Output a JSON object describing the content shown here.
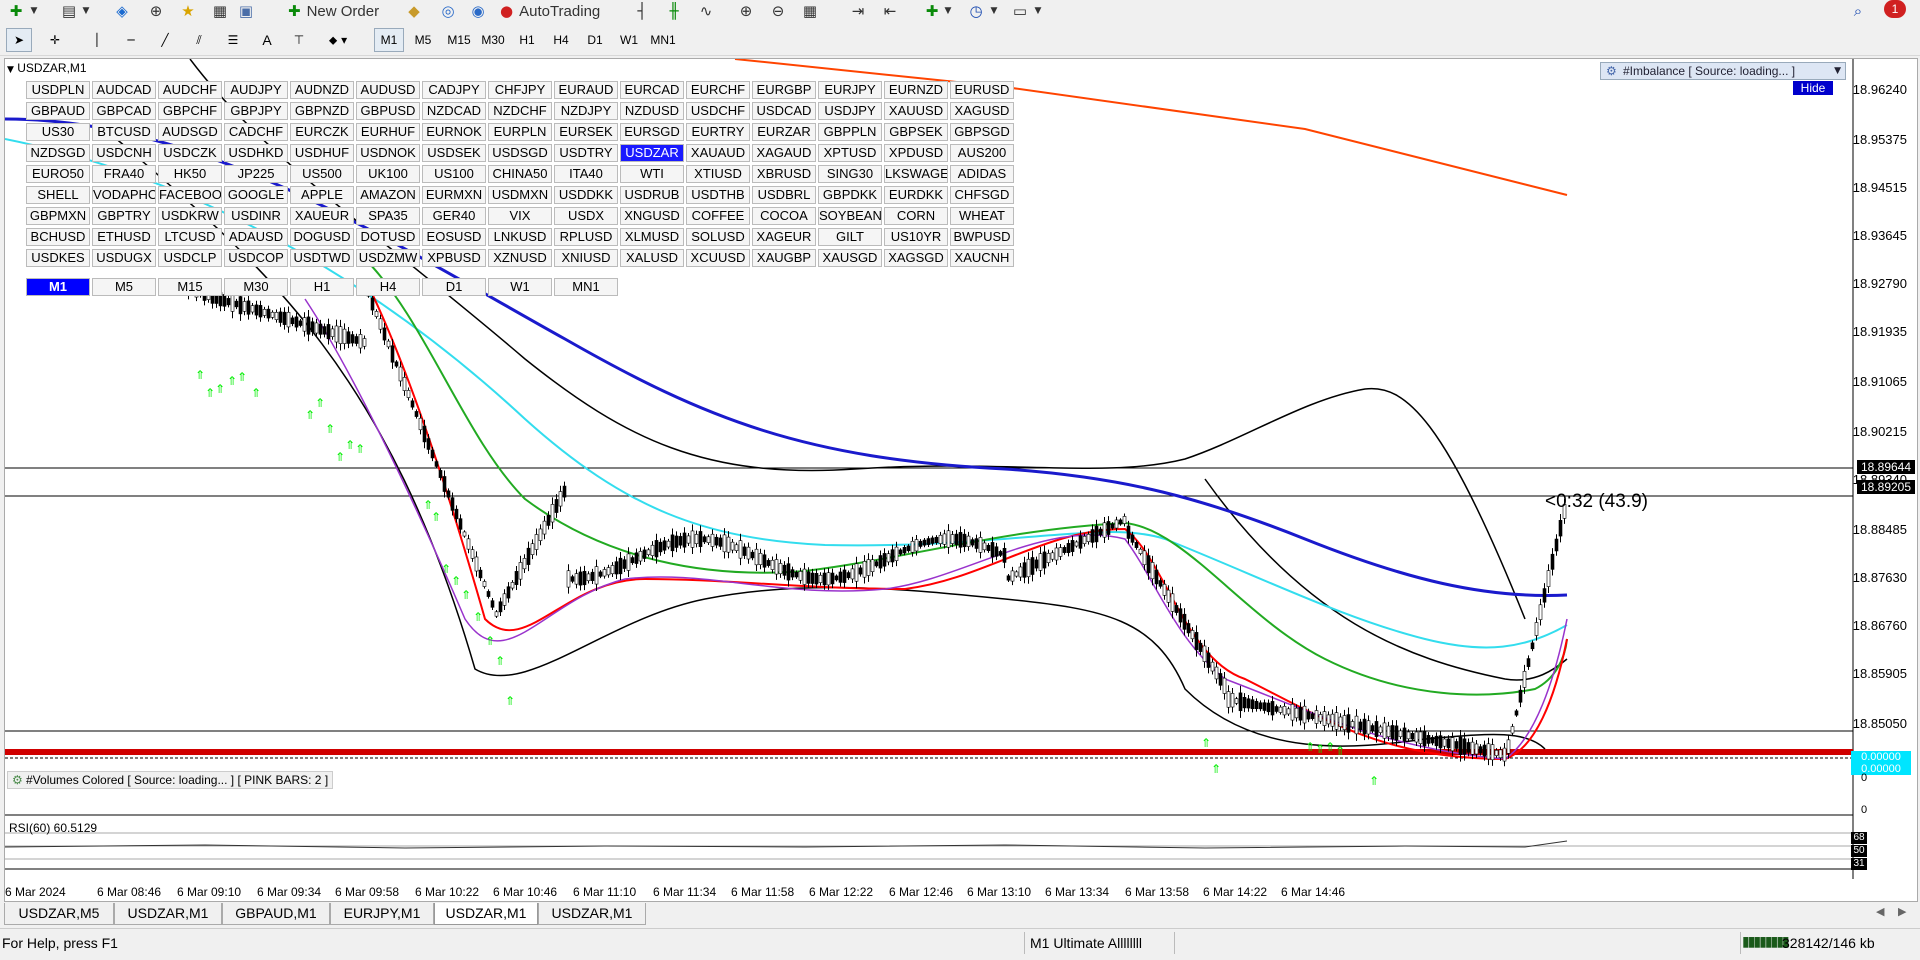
{
  "toolbar": {
    "new_order": "New Order",
    "autotrading": "AutoTrading",
    "timeframes": [
      "M1",
      "M5",
      "M15",
      "M30",
      "H1",
      "H4",
      "D1",
      "W1",
      "MN1"
    ],
    "selected_tf": "M1",
    "notification_count": "1"
  },
  "chart": {
    "title": "USDZAR,M1",
    "countdown": "<0:32 (43.9)",
    "price_labels": [
      "18.96240",
      "18.95375",
      "18.94515",
      "18.93645",
      "18.92790",
      "18.91935",
      "18.91065",
      "18.90215",
      "18.89644",
      "18.89340",
      "18.89205",
      "18.88485",
      "18.87630",
      "18.86760",
      "18.85905",
      "18.85050"
    ],
    "price_tags": [
      "18.89644",
      "18.89205"
    ],
    "date_labels": [
      "6 Mar 2024",
      "6 Mar 08:46",
      "6 Mar 09:10",
      "6 Mar 09:34",
      "6 Mar 09:58",
      "6 Mar 10:22",
      "6 Mar 10:46",
      "6 Mar 11:10",
      "6 Mar 11:34",
      "6 Mar 11:58",
      "6 Mar 12:22",
      "6 Mar 12:46",
      "6 Mar 13:10",
      "6 Mar 13:34",
      "6 Mar 13:58",
      "6 Mar 14:22",
      "6 Mar 14:46"
    ],
    "colors": {
      "ema_fast": "#ff0000",
      "ema_mid": "#9933cc",
      "ema_green": "#22aa22",
      "ema_cyan": "#33ddee",
      "ema_blue": "#1a1acc",
      "bands": "#000000",
      "orange": "#ff4400",
      "arrows": "#00ee00"
    }
  },
  "symbols": [
    [
      "USDPLN",
      "AUDCAD",
      "AUDCHF",
      "AUDJPY",
      "AUDNZD",
      "AUDUSD",
      "CADJPY",
      "CHFJPY",
      "EURAUD",
      "EURCAD",
      "EURCHF",
      "EURGBP",
      "EURJPY",
      "EURNZD",
      "EURUSD"
    ],
    [
      "GBPAUD",
      "GBPCAD",
      "GBPCHF",
      "GBPJPY",
      "GBPNZD",
      "GBPUSD",
      "NZDCAD",
      "NZDCHF",
      "NZDJPY",
      "NZDUSD",
      "USDCHF",
      "USDCAD",
      "USDJPY",
      "XAUUSD",
      "XAGUSD"
    ],
    [
      "US30",
      "BTCUSD",
      "AUDSGD",
      "CADCHF",
      "EURCZK",
      "EURHUF",
      "EURNOK",
      "EURPLN",
      "EURSEK",
      "EURSGD",
      "EURTRY",
      "EURZAR",
      "GBPPLN",
      "GBPSEK",
      "GBPSGD"
    ],
    [
      "NZDSGD",
      "USDCNH",
      "USDCZK",
      "USDHKD",
      "USDHUF",
      "USDNOK",
      "USDSEK",
      "USDSGD",
      "USDTRY",
      "USDZAR",
      "XAUAUD",
      "XAGAUD",
      "XPTUSD",
      "XPDUSD",
      "AUS200"
    ],
    [
      "EURO50",
      "FRA40",
      "HK50",
      "JP225",
      "US500",
      "UK100",
      "US100",
      "CHINA50",
      "ITA40",
      "WTI",
      "XTIUSD",
      "XBRUSD",
      "SING30",
      "LKSWAGE",
      "ADIDAS"
    ],
    [
      "SHELL",
      "VODAPHONE",
      "FACEBOOK",
      "GOOGLE",
      "APPLE",
      "AMAZON",
      "EURMXN",
      "USDMXN",
      "USDDKK",
      "USDRUB",
      "USDTHB",
      "USDBRL",
      "GBPDKK",
      "EURDKK",
      "CHFSGD"
    ],
    [
      "GBPMXN",
      "GBPTRY",
      "USDKRW",
      "USDINR",
      "XAUEUR",
      "SPA35",
      "GER40",
      "VIX",
      "USDX",
      "XNGUSD",
      "COFFEE",
      "COCOA",
      "SOYBEANS",
      "CORN",
      "WHEAT"
    ],
    [
      "BCHUSD",
      "ETHUSD",
      "LTCUSD",
      "ADAUSD",
      "DOGUSD",
      "DOTUSD",
      "EOSUSD",
      "LNKUSD",
      "RPLUSD",
      "XLMUSD",
      "SOLUSD",
      "XAGEUR",
      "GILT",
      "US10YR",
      "BWPUSD"
    ],
    [
      "USDKES",
      "USDUGX",
      "USDCLP",
      "USDCOP",
      "USDTWD",
      "USDZMW",
      "XPBUSD",
      "XZNUSD",
      "XNIUSD",
      "XALUSD",
      "XCUUSD",
      "XAUGBP",
      "XAUSGD",
      "XAGSGD",
      "XAUCNH"
    ]
  ],
  "active_symbol": "USDZAR",
  "panel_timeframes": [
    "M1",
    "M5",
    "M15",
    "M30",
    "H1",
    "H4",
    "D1",
    "W1",
    "MN1"
  ],
  "imbalance": {
    "label": "#Imbalance [ Source: loading... ]",
    "hide": "Hide"
  },
  "volumes": {
    "label": "#Volumes Colored [ Source: loading... ]  [ PINK BARS: 2 ]",
    "axis_values": [
      "0.00000",
      "0.00000"
    ],
    "scale": [
      "0",
      "0"
    ]
  },
  "rsi": {
    "label": "RSI(60) 60.5129",
    "levels": [
      "68",
      "50",
      "31"
    ]
  },
  "tabs": [
    "USDZAR,M5",
    "USDZAR,M1",
    "GBPAUD,M1",
    "EURJPY,M1",
    "USDZAR,M1",
    "USDZAR,M1"
  ],
  "active_tab": 4,
  "status": {
    "help": "For Help, press F1",
    "profile": "M1 Ultimate Allllllll",
    "traffic": "328142/146 kb"
  }
}
